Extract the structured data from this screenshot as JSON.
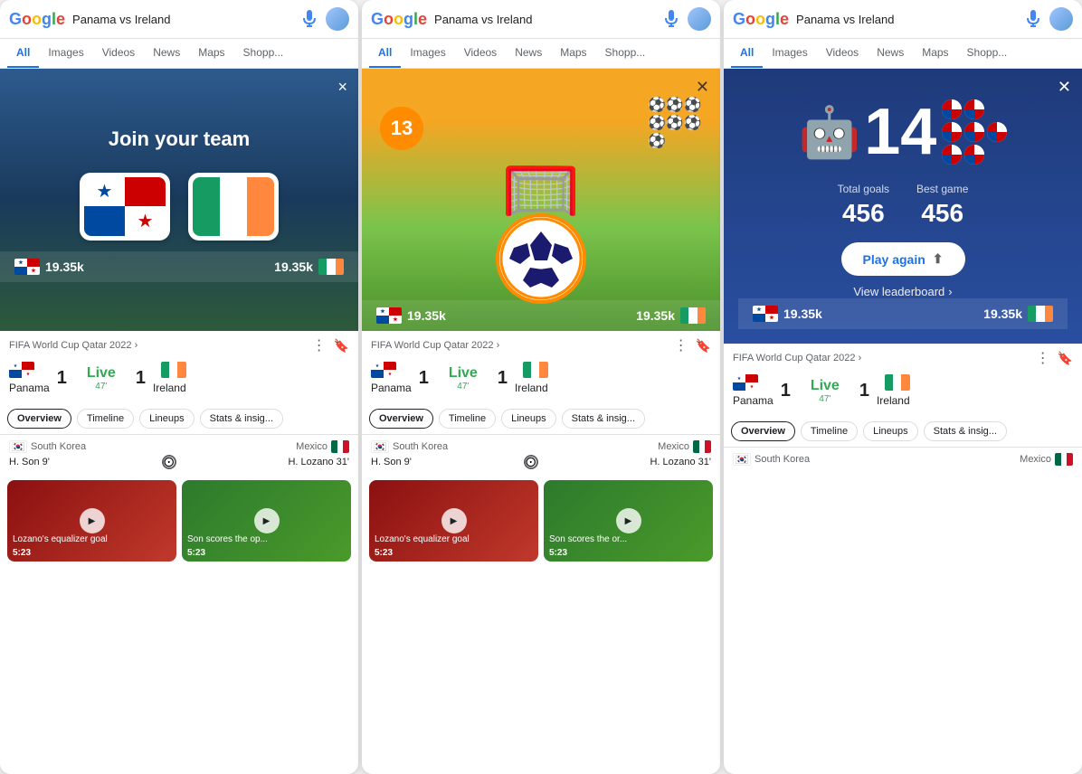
{
  "search": {
    "query": "Panama vs Ireland",
    "mic_label": "microphone",
    "avatar_label": "user avatar"
  },
  "nav": {
    "tabs": [
      "All",
      "Images",
      "Videos",
      "News",
      "Maps",
      "Shopp..."
    ],
    "active": "All"
  },
  "panel1": {
    "game_title": "Join your team",
    "close_label": "×",
    "team1_name": "Panama",
    "team2_name": "Ireland",
    "score_left": "19.35k",
    "score_right": "19.35k",
    "match_title": "FIFA World Cup Qatar 2022 ›",
    "team1_score": "1",
    "team2_score": "1",
    "live_text": "Live",
    "live_min": "47'",
    "tabs": [
      "Overview",
      "Timeline",
      "Lineups",
      "Stats & insig..."
    ],
    "other_team1": "South Korea",
    "other_team2": "Mexico",
    "event1_player": "H. Son 9'",
    "event2_player": "H. Lozano 31'",
    "video1_duration": "5:23",
    "video1_title": "Lozano's equalizer goal",
    "video2_duration": "5:23",
    "video2_title": "Son scores the op..."
  },
  "panel2": {
    "counter": "13",
    "close_label": "✕",
    "score_left": "19.35k",
    "score_right": "19.35k",
    "match_title": "FIFA World Cup Qatar 2022 ›",
    "team1_score": "1",
    "team2_score": "1",
    "live_text": "Live",
    "live_min": "47'",
    "tabs": [
      "Overview",
      "Timeline",
      "Lineups",
      "Stats & insig..."
    ],
    "other_team1": "South Korea",
    "other_team2": "Mexico",
    "event1_player": "H. Son 9'",
    "event2_player": "H. Lozano 31'",
    "video1_duration": "5:23",
    "video1_title": "Lozano's equalizer goal",
    "video2_duration": "5:23",
    "video2_title": "Son scores the or..."
  },
  "panel3": {
    "big_number": "14",
    "close_label": "✕",
    "total_goals_label": "Total goals",
    "total_goals_val": "456",
    "best_game_label": "Best game",
    "best_game_val": "456",
    "play_again_label": "Play again",
    "leaderboard_label": "View leaderboard",
    "score_left": "19.35k",
    "score_right": "19.35k",
    "match_title": "FIFA World Cup Qatar 2022 ›",
    "team1_score": "1",
    "team2_score": "1",
    "live_text": "Live",
    "live_min": "47'",
    "tabs": [
      "Overview",
      "Timeline",
      "Lineups",
      "Stats & insig..."
    ],
    "other_team1": "South Korea",
    "other_team2": "Mexico"
  }
}
